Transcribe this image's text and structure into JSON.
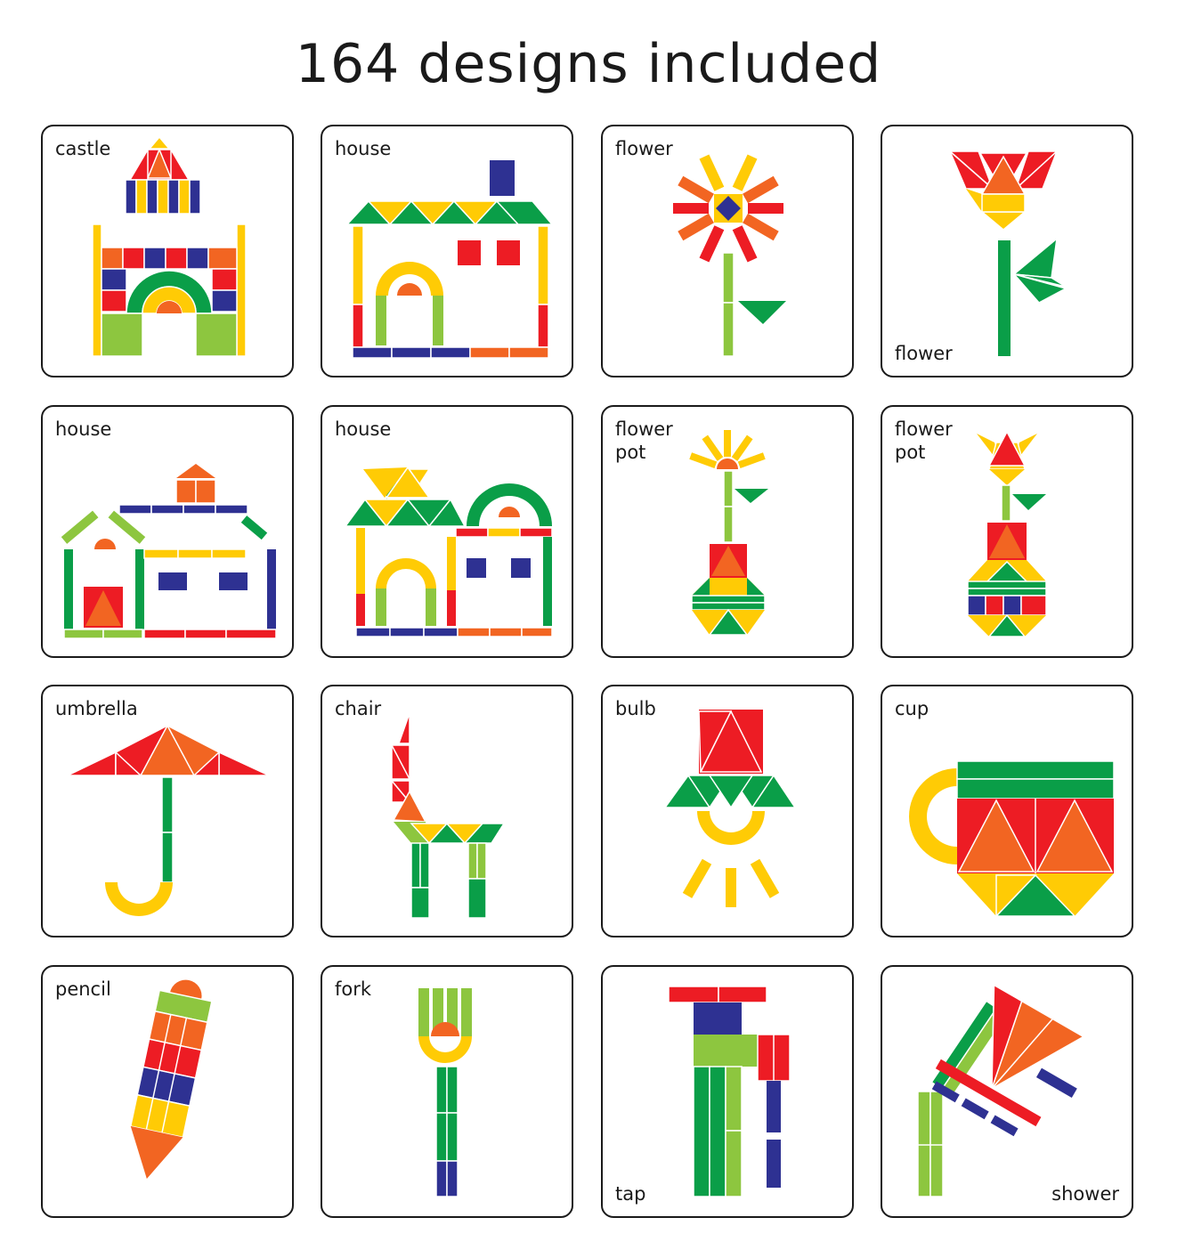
{
  "title": "164 designs included",
  "colors": {
    "red": "#ED1C24",
    "orange": "#F26522",
    "yellow": "#FFCB05",
    "green": "#0A9E48",
    "lime": "#8DC63F",
    "blue": "#2E3192",
    "border": "#1a1a1a"
  },
  "cards": [
    {
      "label": "castle",
      "icon": "castle-icon"
    },
    {
      "label": "house",
      "icon": "house-icon"
    },
    {
      "label": "flower",
      "icon": "sunflower-icon"
    },
    {
      "label": "flower",
      "icon": "tulip-icon"
    },
    {
      "label": "house",
      "icon": "house-icon"
    },
    {
      "label": "house",
      "icon": "house-icon"
    },
    {
      "label": "flower\npot",
      "icon": "flower-pot-icon"
    },
    {
      "label": "flower\npot",
      "icon": "flower-pot-icon"
    },
    {
      "label": "umbrella",
      "icon": "umbrella-icon"
    },
    {
      "label": "chair",
      "icon": "chair-icon"
    },
    {
      "label": "bulb",
      "icon": "bulb-icon"
    },
    {
      "label": "cup",
      "icon": "cup-icon"
    },
    {
      "label": "pencil",
      "icon": "pencil-icon"
    },
    {
      "label": "fork",
      "icon": "fork-icon"
    },
    {
      "label": "tap",
      "icon": "tap-icon"
    },
    {
      "label": "shower",
      "icon": "shower-icon"
    }
  ]
}
